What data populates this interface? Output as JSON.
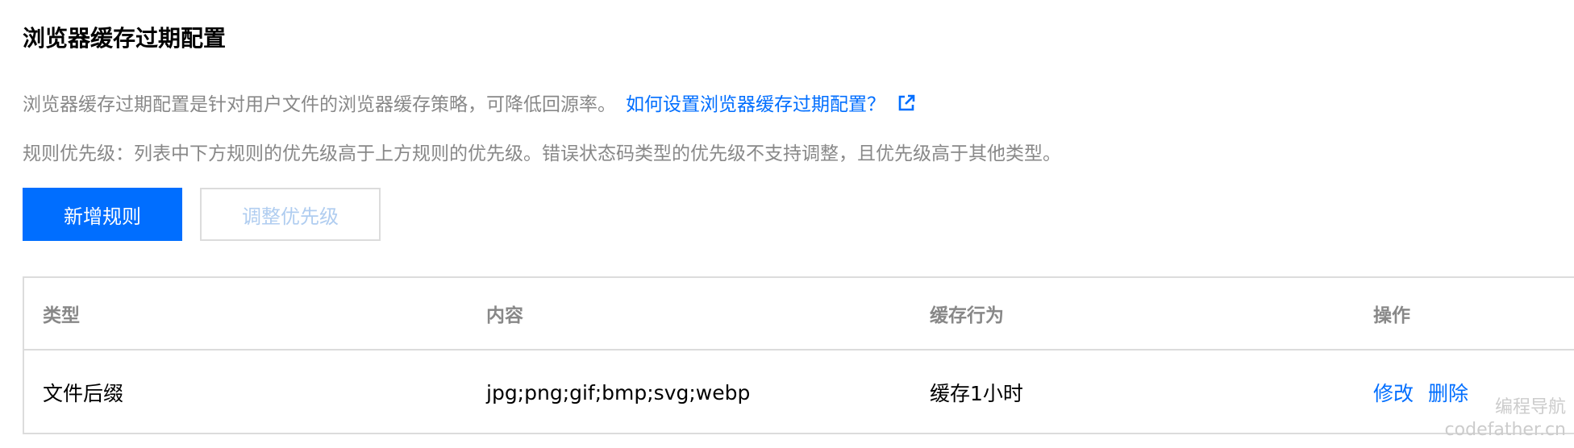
{
  "title": "浏览器缓存过期配置",
  "description": {
    "line1": "浏览器缓存过期配置是针对用户文件的浏览器缓存策略，可降低回源率。",
    "help_link": "如何设置浏览器缓存过期配置？",
    "help_icon": "external-link-icon",
    "line2": "规则优先级：列表中下方规则的优先级高于上方规则的优先级。错误状态码类型的优先级不支持调整，且优先级高于其他类型。"
  },
  "buttons": {
    "add_rule": "新增规则",
    "adjust_priority": "调整优先级"
  },
  "table": {
    "columns": [
      "类型",
      "内容",
      "缓存行为",
      "操作"
    ],
    "rows": [
      {
        "type": "文件后缀",
        "content": "jpg;png;gif;bmp;svg;webp",
        "behavior": "缓存1小时",
        "actions": [
          "修改",
          "删除"
        ]
      }
    ]
  },
  "watermark": {
    "line1": "编程导航",
    "line2": "codefather.cn"
  },
  "colors": {
    "primary": "#006eff",
    "muted_text": "#888888",
    "disabled_text": "#b0cdf0",
    "border": "#dcdcdc"
  }
}
